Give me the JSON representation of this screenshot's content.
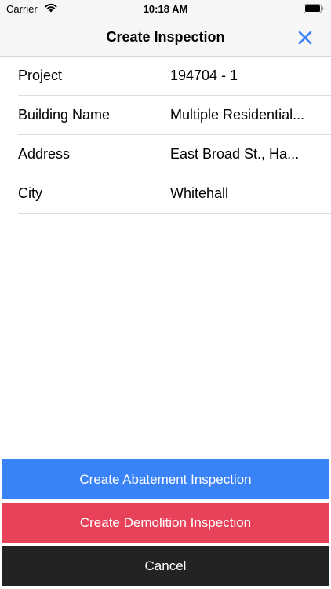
{
  "status_bar": {
    "carrier": "Carrier",
    "time": "10:18 AM",
    "wifi_icon": "wifi-icon",
    "battery_icon": "battery-icon"
  },
  "nav": {
    "title": "Create Inspection",
    "close_icon": "close-icon",
    "accent_color": "#3a82f7"
  },
  "fields": [
    {
      "label": "Project",
      "value": "194704 - 1"
    },
    {
      "label": "Building Name",
      "value": "Multiple Residential..."
    },
    {
      "label": "Address",
      "value": "East Broad St., Ha..."
    },
    {
      "label": "City",
      "value": "Whitehall"
    }
  ],
  "actions": {
    "abatement": "Create Abatement Inspection",
    "demolition": "Create Demolition Inspection",
    "cancel": "Cancel"
  },
  "colors": {
    "abatement": "#3a82f7",
    "demolition": "#e8425a",
    "cancel": "#232326"
  }
}
